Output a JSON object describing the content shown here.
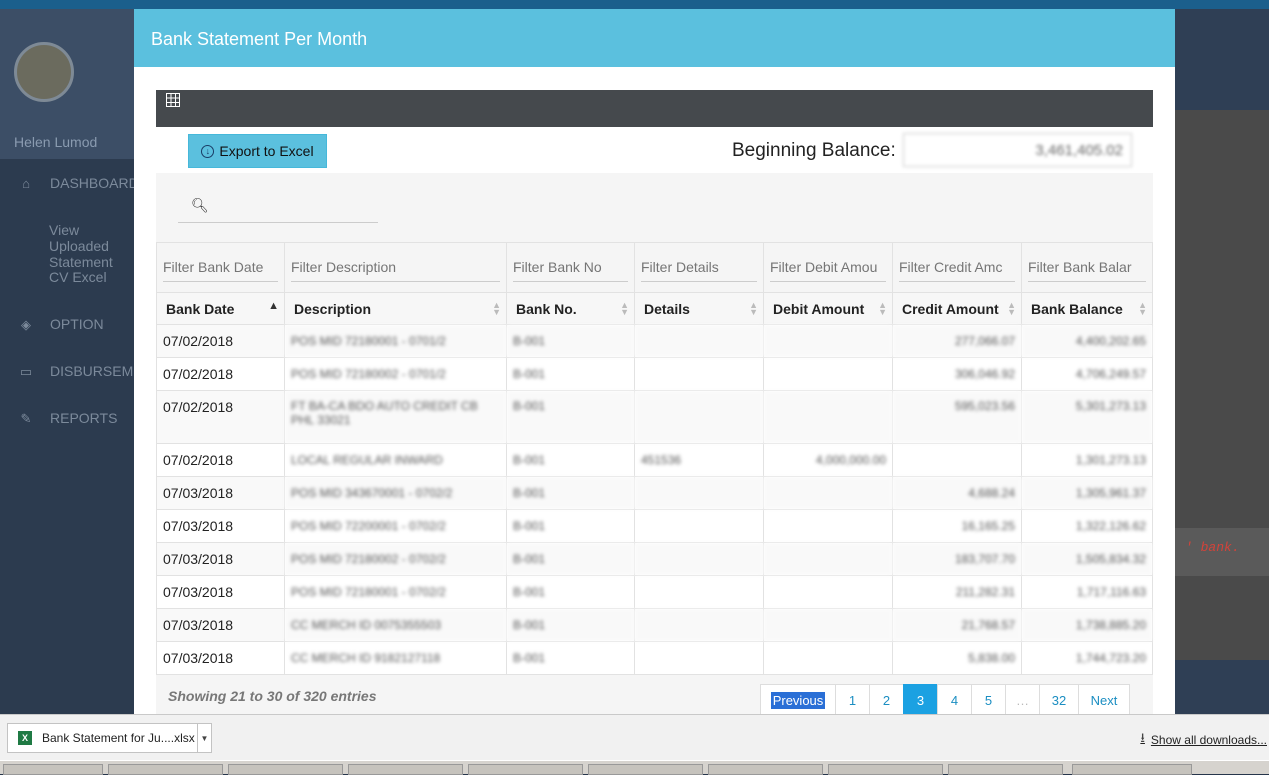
{
  "background": {
    "username": "Helen Lumod",
    "nav": [
      {
        "icon": "home-icon",
        "label": "DASHBOARD"
      },
      {
        "icon": "cube-icon",
        "label": "OPTION"
      },
      {
        "icon": "inbox-icon",
        "label": "DISBURSEME"
      },
      {
        "icon": "edit-icon",
        "label": "REPORTS"
      }
    ],
    "subnav": [
      "View Uploaded Statement",
      "CV Excel"
    ],
    "code_snippet": "' bank."
  },
  "modal": {
    "title": "Bank Statement Per Month",
    "toolbar_icon": "grid-icon",
    "export_label": "Export to Excel",
    "beginning_balance_label": "Beginning Balance:",
    "beginning_balance_value": "3,461,405.02",
    "search_placeholder": ""
  },
  "table": {
    "filters": [
      "Filter Bank Date",
      "Filter Description",
      "Filter Bank No",
      "Filter Details",
      "Filter Debit Amou",
      "Filter Credit Amc",
      "Filter Bank Balar"
    ],
    "headers": [
      "Bank Date",
      "Description",
      "Bank No.",
      "Details",
      "Debit Amount",
      "Credit Amount",
      "Bank Balance"
    ],
    "rows": [
      {
        "date": "07/02/2018",
        "desc": "POS MID 72180001 - 0701/2",
        "bank": "B-001",
        "details": "",
        "debit": "",
        "credit": "277,066.07",
        "balance": "4,400,202.65"
      },
      {
        "date": "07/02/2018",
        "desc": "POS MID 72180002 - 0701/2",
        "bank": "B-001",
        "details": "",
        "debit": "",
        "credit": "306,046.92",
        "balance": "4,706,249.57"
      },
      {
        "date": "07/02/2018",
        "desc": "FT BA-CA BDO AUTO CREDIT CB PHL 33021",
        "bank": "B-001",
        "details": "",
        "debit": "",
        "credit": "595,023.56",
        "balance": "5,301,273.13"
      },
      {
        "date": "07/02/2018",
        "desc": "LOCAL REGULAR INWARD",
        "bank": "B-001",
        "details": "451536",
        "debit": "4,000,000.00",
        "credit": "",
        "balance": "1,301,273.13"
      },
      {
        "date": "07/03/2018",
        "desc": "POS MID 343670001 - 0702/2",
        "bank": "B-001",
        "details": "",
        "debit": "",
        "credit": "4,688.24",
        "balance": "1,305,961.37"
      },
      {
        "date": "07/03/2018",
        "desc": "POS MID 72200001 - 0702/2",
        "bank": "B-001",
        "details": "",
        "debit": "",
        "credit": "16,165.25",
        "balance": "1,322,126.62"
      },
      {
        "date": "07/03/2018",
        "desc": "POS MID 72180002 - 0702/2",
        "bank": "B-001",
        "details": "",
        "debit": "",
        "credit": "183,707.70",
        "balance": "1,505,834.32"
      },
      {
        "date": "07/03/2018",
        "desc": "POS MID 72180001 - 0702/2",
        "bank": "B-001",
        "details": "",
        "debit": "",
        "credit": "211,282.31",
        "balance": "1,717,116.63"
      },
      {
        "date": "07/03/2018",
        "desc": "CC MERCH ID 0075355503",
        "bank": "B-001",
        "details": "",
        "debit": "",
        "credit": "21,768.57",
        "balance": "1,738,885.20"
      },
      {
        "date": "07/03/2018",
        "desc": "CC MERCH ID 9182127118",
        "bank": "B-001",
        "details": "",
        "debit": "",
        "credit": "5,838.00",
        "balance": "1,744,723.20"
      }
    ]
  },
  "footer": {
    "info": "Showing 21 to 30 of 320 entries",
    "prev": "Previous",
    "pages": [
      "1",
      "2",
      "3",
      "4",
      "5",
      "…",
      "32"
    ],
    "active_page": "3",
    "next": "Next"
  },
  "downloads": {
    "file": "Bank Statement for Ju....xlsx",
    "show_all": "Show all downloads..."
  }
}
